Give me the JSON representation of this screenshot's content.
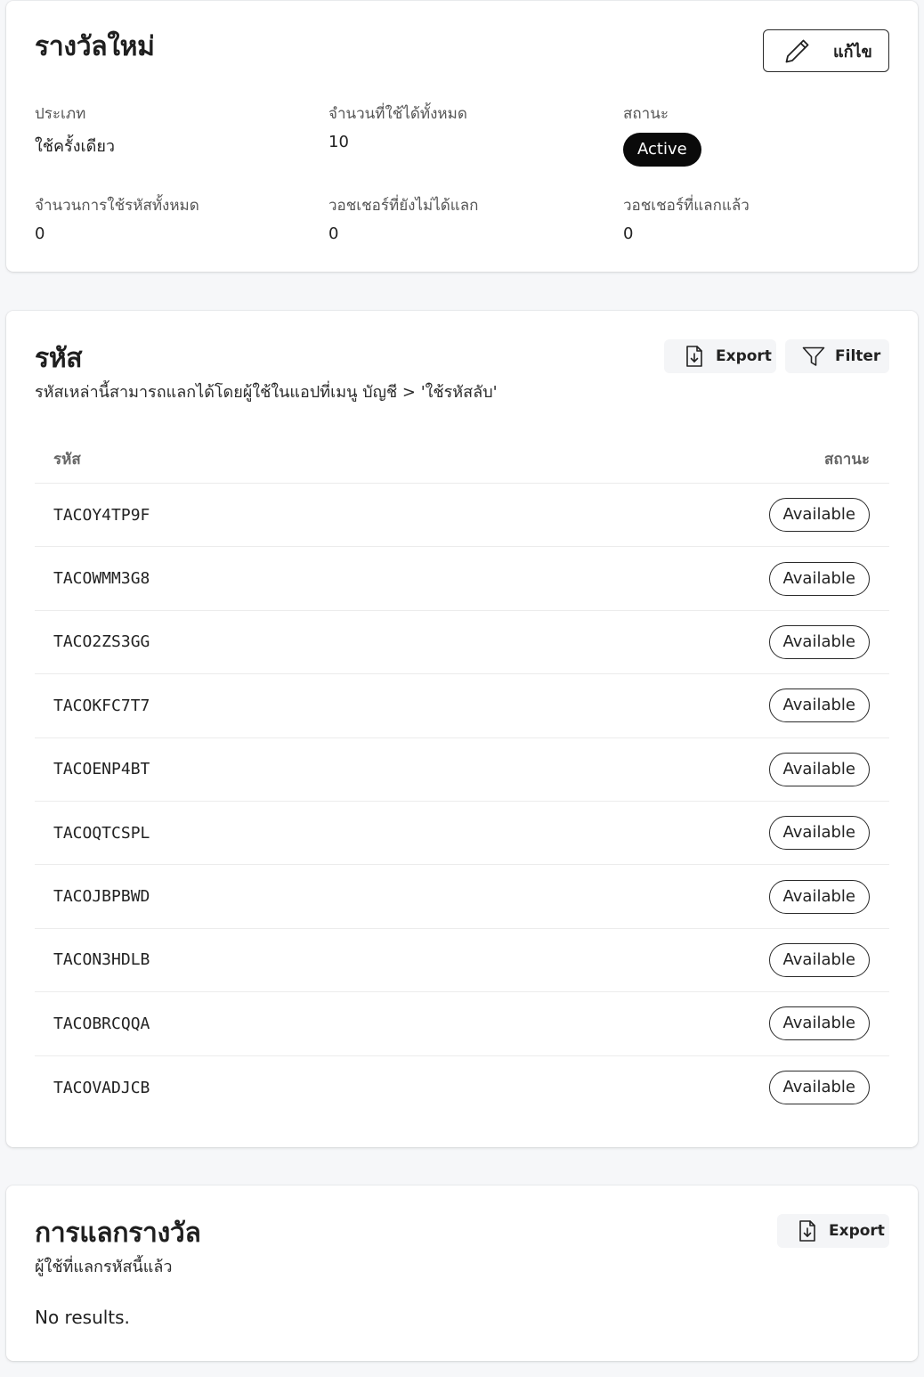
{
  "reward": {
    "title": "รางวัลใหม่",
    "edit_label": "แก้ไข",
    "stats": {
      "type_label": "ประเภท",
      "type_value": "ใช้ครั้งเดียว",
      "available_label": "จำนวนที่ใช้ได้ทั้งหมด",
      "available_value": "10",
      "status_label": "สถานะ",
      "status_value": "Active",
      "total_used_label": "จำนวนการใช้รหัสทั้งหมด",
      "total_used_value": "0",
      "unredeemed_label": "วอชเชอร์ที่ยังไม่ได้แลก",
      "unredeemed_value": "0",
      "redeemed_label": "วอชเชอร์ที่แลกแล้ว",
      "redeemed_value": "0"
    }
  },
  "codes": {
    "title": "รหัส",
    "subtitle": "รหัสเหล่านี้สามารถแลกได้โดยผู้ใช้ในแอปที่เมนู บัญชี > 'ใช้รหัสลับ'",
    "export_label": "Export",
    "filter_label": "Filter",
    "columns": [
      "รหัส",
      "สถานะ"
    ],
    "rows": [
      {
        "code": "TACOY4TP9F",
        "status": "Available"
      },
      {
        "code": "TACOWMM3G8",
        "status": "Available"
      },
      {
        "code": "TACO2ZS3GG",
        "status": "Available"
      },
      {
        "code": "TACOKFC7T7",
        "status": "Available"
      },
      {
        "code": "TACOENP4BT",
        "status": "Available"
      },
      {
        "code": "TACOQTCSPL",
        "status": "Available"
      },
      {
        "code": "TACOJBPBWD",
        "status": "Available"
      },
      {
        "code": "TACON3HDLB",
        "status": "Available"
      },
      {
        "code": "TACOBRCQQA",
        "status": "Available"
      },
      {
        "code": "TACOVADJCB",
        "status": "Available"
      }
    ]
  },
  "redemptions": {
    "title": "การแลกรางวัล",
    "subtitle": "ผู้ใช้ที่แลกรหัสนี้แล้ว",
    "export_label": "Export",
    "empty_text": "No results."
  },
  "icons": {
    "edit": "pencil-icon",
    "export": "file-download-icon",
    "filter": "funnel-icon"
  },
  "colors": {
    "background": "#f6f7f9",
    "card": "#ffffff",
    "badge_active": "#0a0a0a",
    "soft_button": "#f4f5f7"
  }
}
